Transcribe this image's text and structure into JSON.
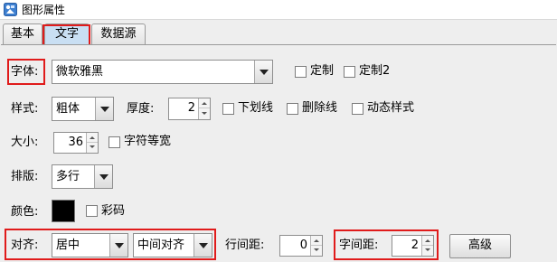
{
  "window": {
    "title": "图形属性"
  },
  "tabs": [
    {
      "label": "基本",
      "active": false
    },
    {
      "label": "文字",
      "active": true
    },
    {
      "label": "数据源",
      "active": false
    }
  ],
  "font": {
    "label": "字体:",
    "value": "微软雅黑",
    "custom_label": "定制",
    "custom2_label": "定制2"
  },
  "style": {
    "label": "样式:",
    "value": "粗体",
    "thickness_label": "厚度:",
    "thickness_value": "2",
    "underline_label": "下划线",
    "strikethrough_label": "删除线",
    "dynamic_label": "动态样式"
  },
  "size": {
    "label": "大小:",
    "value": "36",
    "monospace_label": "字符等宽"
  },
  "layout": {
    "label": "排版:",
    "value": "多行"
  },
  "color": {
    "label": "颜色:",
    "swatch": "#000000",
    "colorful_label": "彩码"
  },
  "align": {
    "label": "对齐:",
    "horizontal_value": "居中",
    "vertical_value": "中间对齐",
    "line_spacing_label": "行间距:",
    "line_spacing_value": "0",
    "char_spacing_label": "字间距:",
    "char_spacing_value": "2",
    "advanced_label": "高级"
  },
  "highlight_color": "#e01b1b"
}
